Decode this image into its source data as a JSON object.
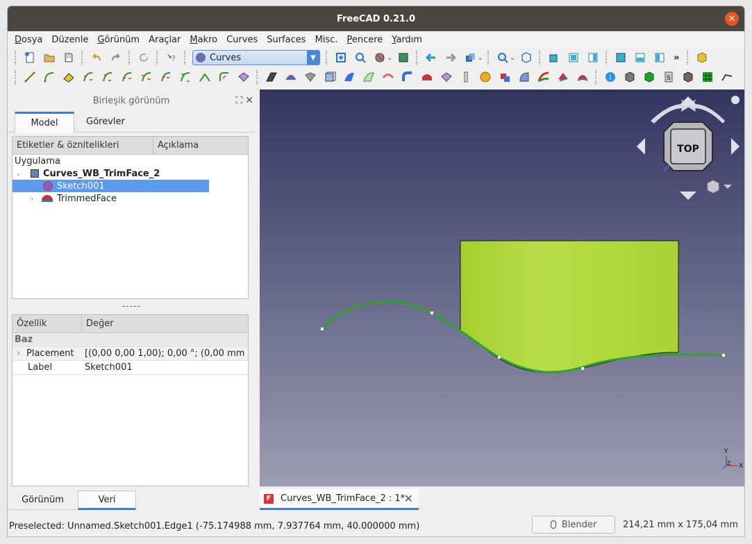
{
  "window": {
    "title": "FreeCAD 0.21.0"
  },
  "menu": [
    {
      "u": "D",
      "rest": "osya"
    },
    {
      "u": "",
      "rest": "Düzenle"
    },
    {
      "u": "G",
      "rest": "örünüm"
    },
    {
      "u": "",
      "rest": "Araçlar"
    },
    {
      "u": "M",
      "rest": "akro"
    },
    {
      "u": "",
      "rest": "Curves"
    },
    {
      "u": "",
      "rest": "Surfaces"
    },
    {
      "u": "",
      "rest": "Misc."
    },
    {
      "u": "P",
      "rest": "encere"
    },
    {
      "u": "Y",
      "rest": "ardım"
    }
  ],
  "toolbar": {
    "workbench": "Curves",
    "overflow": "»"
  },
  "combo": {
    "title": "Birleşik görünüm",
    "tabs": [
      "Model",
      "Görevler"
    ],
    "tree_headers": [
      "Etiketler & öznitelikleri",
      "Açıklama"
    ],
    "tree_root": "Uygulama",
    "doc": "Curves_WB_TrimFace_2",
    "items": [
      "Sketch001",
      "TrimmedFace"
    ],
    "splitter": "-----",
    "prop_headers": [
      "Özellik",
      "Değer"
    ],
    "group": "Baz",
    "props": [
      {
        "name": "Placement",
        "value": "[(0,00 0,00 1,00); 0,00 °; (0,00 mm  ..."
      },
      {
        "name": "Label",
        "value": "Sketch001"
      }
    ],
    "bottom_tabs": [
      "Görünüm",
      "Veri"
    ]
  },
  "navcube": {
    "face": "TOP"
  },
  "axis": {
    "y": "Y",
    "x": "X",
    "z": "Z"
  },
  "doc_tab": {
    "label": "Curves_WB_TrimFace_2 : 1*"
  },
  "status": {
    "text": "Preselected: Unnamed.Sketch001.Edge1 (-75.174988 mm, 7.937764 mm, 40.000000 mm)",
    "nav": "Blender",
    "dims": "214,21 mm x 175,04 mm"
  },
  "colors": {
    "accent": "#3d7dd6",
    "selection": "#5a9bf0",
    "surface": "#b5dd3c",
    "curve": "#2aa52a",
    "close": "#e95420"
  }
}
